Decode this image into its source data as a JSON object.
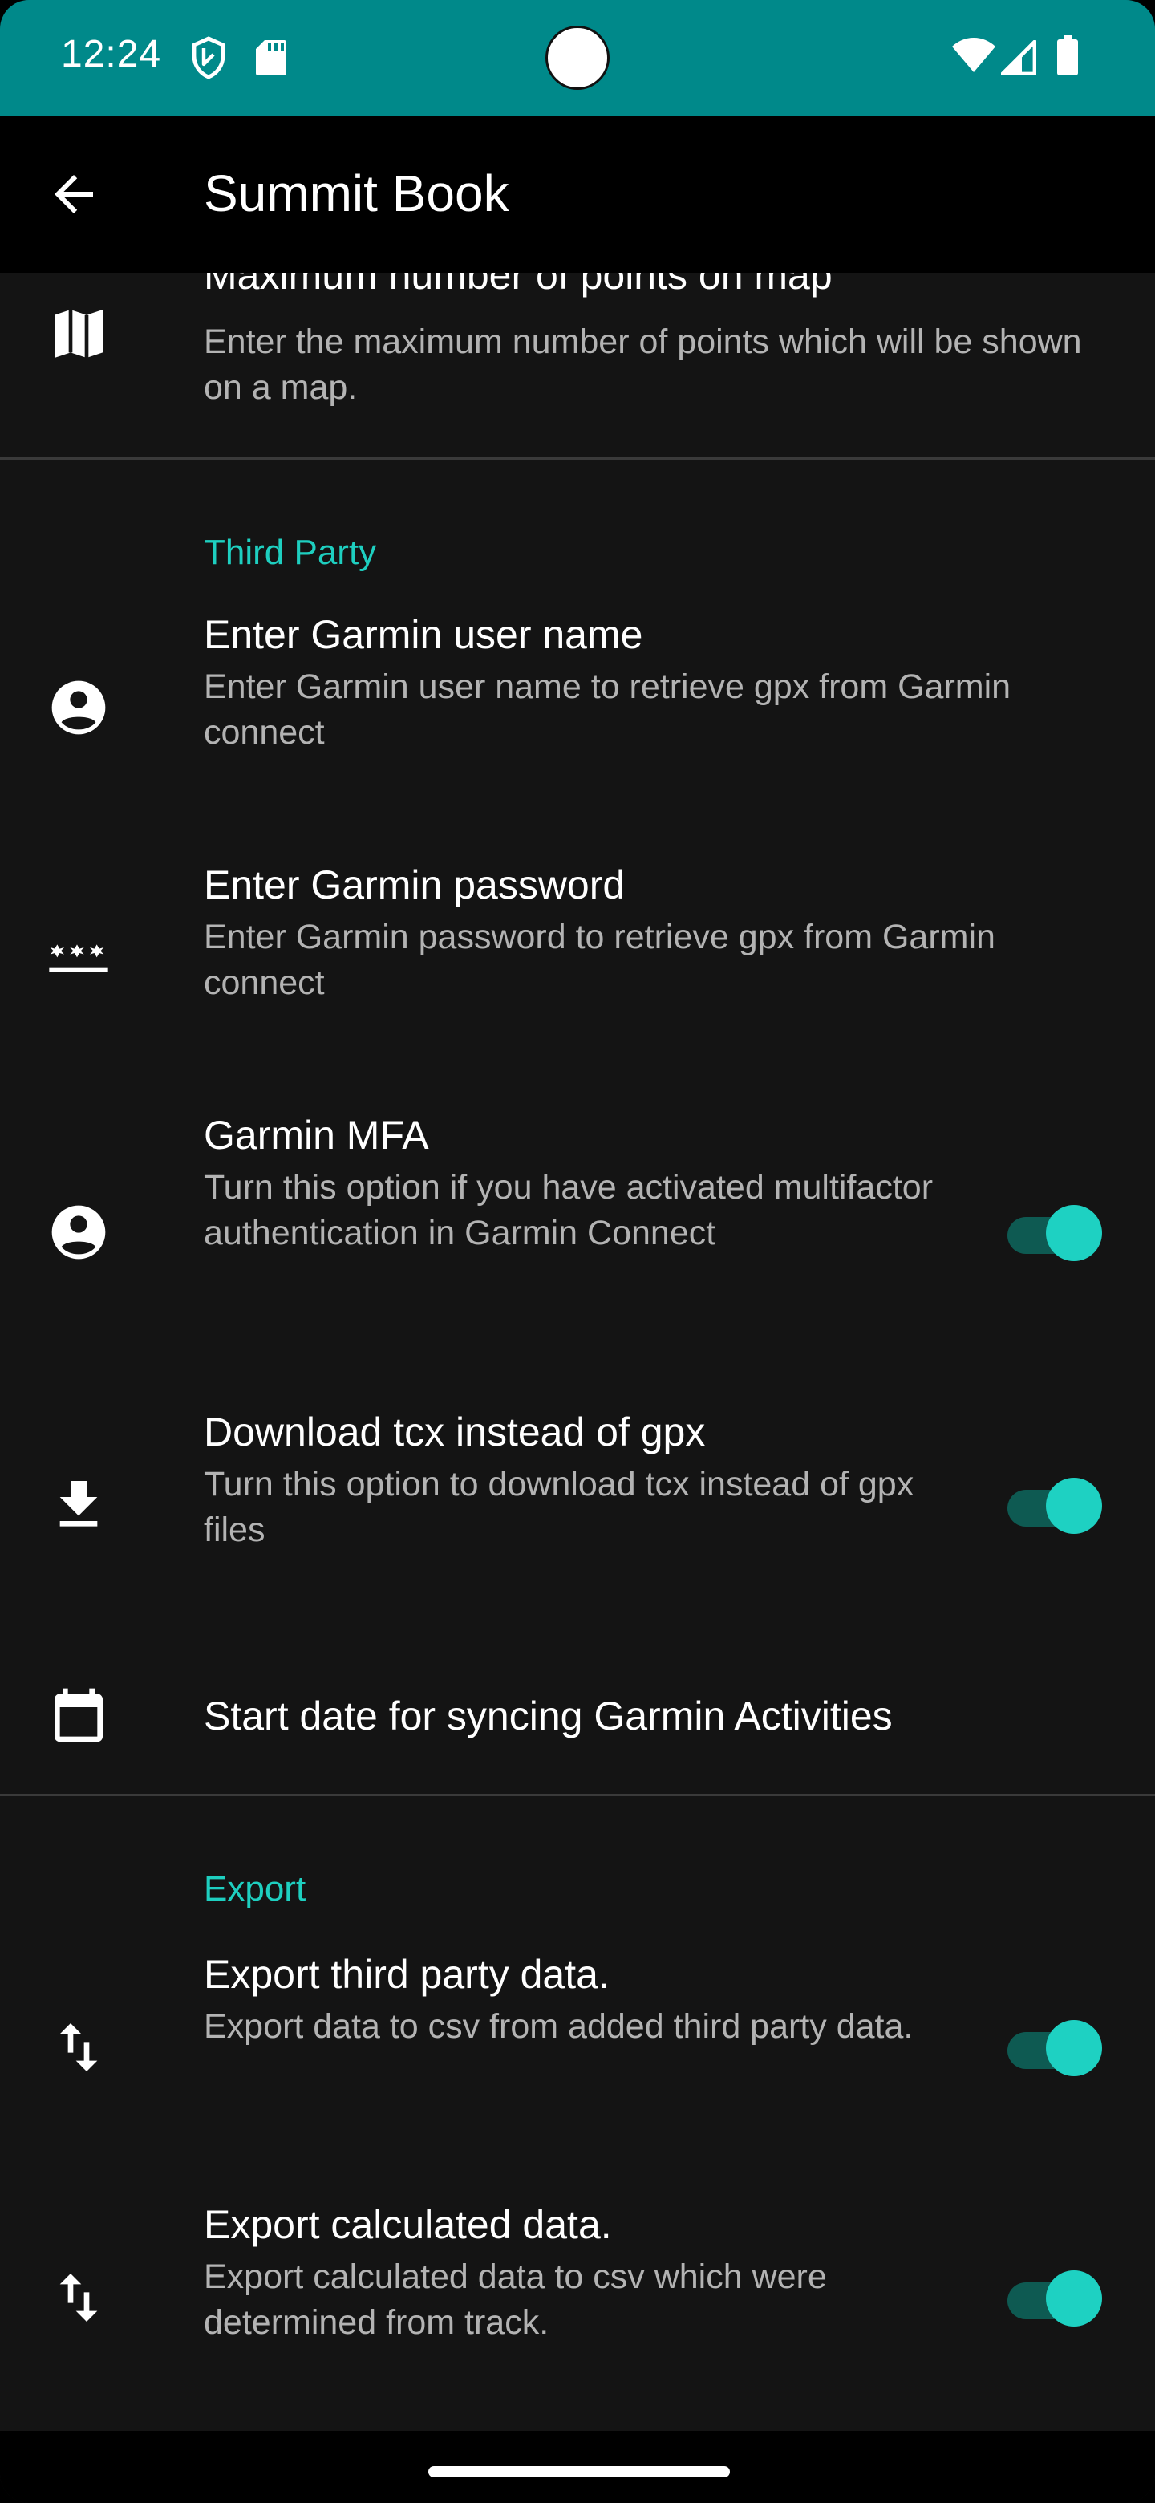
{
  "status_bar": {
    "time": "12:24",
    "background": "#00898A",
    "left_icons": [
      "shield-icon",
      "sd-card-icon"
    ],
    "right_icons": [
      "wifi-icon",
      "cellular-signal-icon",
      "battery-icon"
    ]
  },
  "toolbar": {
    "title": "Summit Book",
    "back_icon": "arrow-back-icon"
  },
  "preferences": {
    "max_points": {
      "title": "Maximum number of points on map",
      "summary": "Enter the maximum number of points which will be shown on a map.",
      "icon": "map-icon"
    },
    "third_party": {
      "category": "Third Party",
      "garmin_user": {
        "title": "Enter Garmin user name",
        "summary": "Enter Garmin user name to retrieve gpx from Garmin connect",
        "icon": "account-circle-icon"
      },
      "garmin_password": {
        "title": "Enter Garmin password",
        "summary": "Enter Garmin password to retrieve gpx from Garmin connect",
        "icon": "password-icon"
      },
      "garmin_mfa": {
        "title": "Garmin MFA",
        "summary": "Turn this option if you have activated multifactor authentication in Garmin Connect",
        "icon": "account-circle-icon",
        "enabled": true
      },
      "download_tcx": {
        "title": "Download tcx instead of gpx",
        "summary": "Turn this option to download tcx instead of gpx files",
        "icon": "download-icon",
        "enabled": true
      },
      "start_date": {
        "title": "Start date for syncing Garmin Activities",
        "icon": "calendar-icon"
      }
    },
    "export": {
      "category": "Export",
      "third_party_data": {
        "title": "Export third party data.",
        "summary": "Export data to csv from added third party data.",
        "icon": "import-export-icon",
        "enabled": true
      },
      "calculated_data": {
        "title": "Export calculated data.",
        "summary": "Export calculated data to csv which were determined from track.",
        "icon": "import-export-icon",
        "enabled": true
      }
    }
  },
  "colors": {
    "accent": "#1ED1C2",
    "background": "#141414",
    "switch_track": "#0E5A52"
  }
}
